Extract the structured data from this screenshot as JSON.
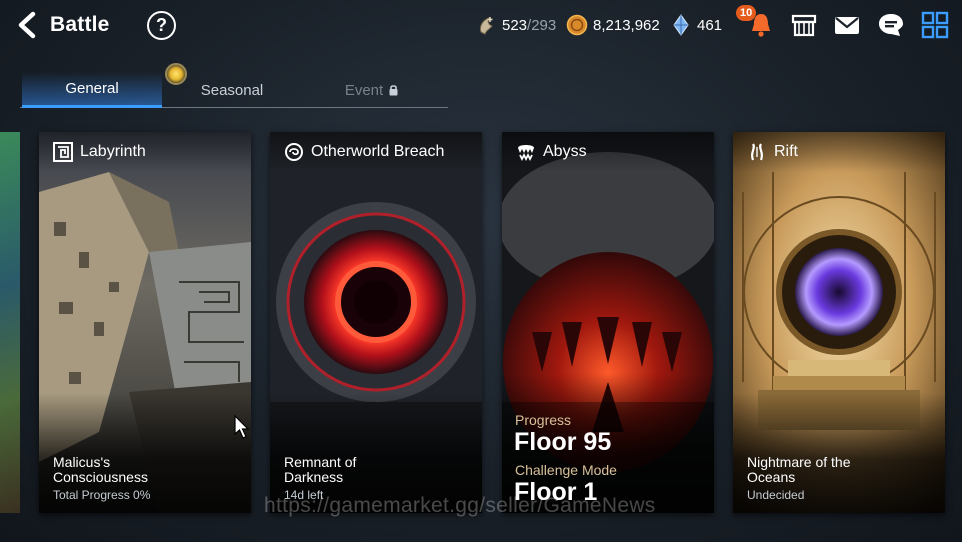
{
  "header": {
    "back_label": "Battle",
    "help_label": "?"
  },
  "resources": {
    "stamina_current": "523",
    "stamina_max": "/293",
    "gold": "8,213,962",
    "crystals": "461",
    "notification_count": "10"
  },
  "tabs": [
    {
      "label": "General",
      "state": "active"
    },
    {
      "label": "Seasonal",
      "state": "inactive"
    },
    {
      "label": "Event",
      "state": "locked"
    }
  ],
  "cards": [
    {
      "name": "Labyrinth",
      "icon": "maze-icon",
      "title": "Malicus's\nConsciousness",
      "subtitle": "Total Progress 0%"
    },
    {
      "name": "Otherworld Breach",
      "icon": "portal-swirl-icon",
      "title": "Remnant of\nDarkness",
      "subtitle": "14d left"
    },
    {
      "name": "Abyss",
      "icon": "abyss-jaws-icon",
      "progress_label": "Progress",
      "progress_value": "Floor 95",
      "challenge_label": "Challenge Mode",
      "challenge_value": "Floor 1"
    },
    {
      "name": "Rift",
      "icon": "rift-icon",
      "title": "Nightmare of the\nOceans",
      "subtitle": "Undecided"
    }
  ],
  "watermark": "https://gamemarket.gg/seller/GameNews",
  "colors": {
    "tab_active": "#3b9dff",
    "badge": "#e45b1c",
    "progress_label": "#d8c19a"
  }
}
